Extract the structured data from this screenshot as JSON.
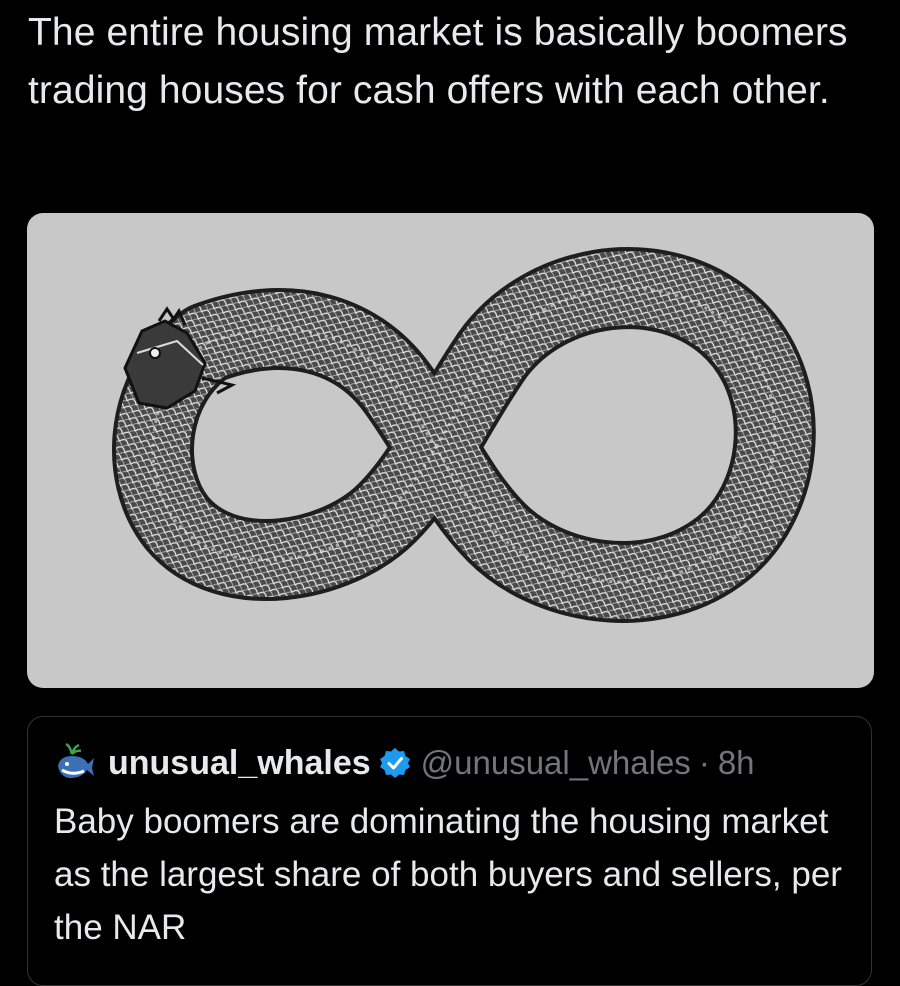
{
  "tweet": {
    "text": "The entire housing market is basically boomers trading houses for cash offers with each other."
  },
  "media": {
    "icon": "ouroboros-infinity-snake-image",
    "background_color": "#c8c8c8"
  },
  "quoted_tweet": {
    "avatar_icon": "whale-avatar-icon",
    "display_name": "unusual_whales",
    "verified_icon": "verified-badge-icon",
    "verified_color": "#1d9bf0",
    "handle": "@unusual_whales",
    "separator": "·",
    "time": "8h",
    "text": "Baby boomers are dominating the housing market as the largest share of both buyers and sellers, per the NAR"
  },
  "colors": {
    "background": "#000000",
    "text_primary": "#e7e9ea",
    "text_secondary": "#71767b",
    "border": "#2f3336"
  }
}
